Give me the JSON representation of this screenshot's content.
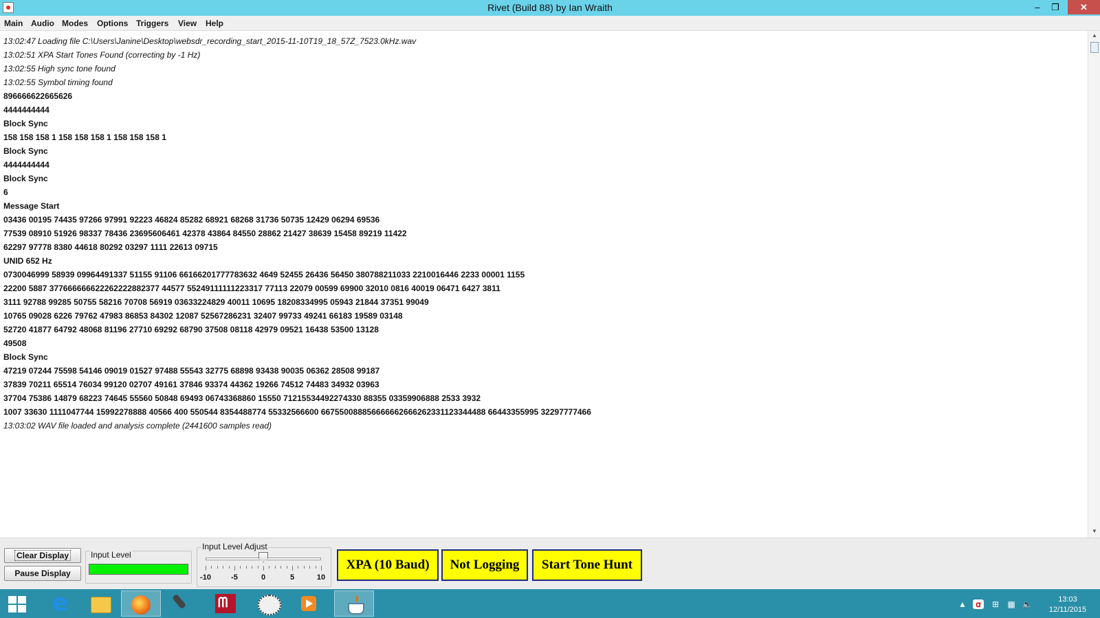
{
  "window": {
    "title": "Rivet (Build 88) by Ian Wraith",
    "minimize_glyph": "–",
    "maximize_glyph": "❐",
    "close_glyph": "✕"
  },
  "menu": [
    "Main",
    "Audio",
    "Modes",
    "Options",
    "Triggers",
    "View",
    "Help"
  ],
  "log": [
    {
      "text": "13:02:47 Loading file C:\\Users\\Janine\\Desktop\\websdr_recording_start_2015-11-10T19_18_57Z_7523.0kHz.wav",
      "style": "info"
    },
    {
      "text": "13:02:51 XPA Start Tones Found (correcting by -1 Hz)",
      "style": "info"
    },
    {
      "text": "13:02:55 High sync tone found",
      "style": "info"
    },
    {
      "text": "13:02:55 Symbol timing found",
      "style": "info"
    },
    {
      "text": "896666622665626",
      "style": "bold"
    },
    {
      "text": "4444444444",
      "style": "bold"
    },
    {
      "text": "Block Sync",
      "style": "bold"
    },
    {
      "text": "158 158 158 1 158 158 158 1 158 158 158 1",
      "style": "bold"
    },
    {
      "text": "Block Sync",
      "style": "bold"
    },
    {
      "text": "4444444444",
      "style": "bold"
    },
    {
      "text": "Block Sync",
      "style": "bold"
    },
    {
      "text": "6",
      "style": "bold"
    },
    {
      "text": "Message Start",
      "style": "bold"
    },
    {
      "text": "03436 00195 74435 97266 97991 92223 46824 85282 68921 68268 31736 50735 12429 06294 69536",
      "style": "bold"
    },
    {
      "text": "77539 08910 51926 98337 78436 23695606461 42378 43864 84550 28862 21427 38639 15458 89219 11422",
      "style": "bold"
    },
    {
      "text": "62297 97778 8380 44618 80292 03297 1111 22613 09715",
      "style": "bold"
    },
    {
      "text": "UNID 652 Hz",
      "style": "bold"
    },
    {
      "text": "0730046999 58939 09964491337 51155 91106 66166201777783632 4649 52455 26436 56450 380788211033 2210016446 2233 00001 1155",
      "style": "bold"
    },
    {
      "text": "22200 5887 377666666622262222882377 44577 55249111111223317 77113 22079 00599 69900 32010 0816 40019 06471 6427 3811",
      "style": "bold"
    },
    {
      "text": "3111 92788 99285 50755 58216 70708 56919 03633224829 40011 10695 18208334995 05943 21844 37351 99049",
      "style": "bold"
    },
    {
      "text": "10765 09028 6226 79762 47983 86853 84302 12087 52567286231 32407 99733 49241 66183 19589 03148",
      "style": "bold"
    },
    {
      "text": "52720 41877 64792 48068 81196 27710 69292 68790 37508 08118 42979 09521 16438 53500 13128",
      "style": "bold"
    },
    {
      "text": "49508",
      "style": "bold"
    },
    {
      "text": "Block Sync",
      "style": "bold"
    },
    {
      "text": "47219 07244 75598 54146 09019 01527 97488 55543 32775 68898 93438 90035 06362 28508 99187",
      "style": "bold"
    },
    {
      "text": "37839 70211 65514 76034 99120 02707 49161 37846 93374 44362 19266 74512 74483 34932 03963",
      "style": "bold"
    },
    {
      "text": "37704 75386 14879 68223 74645 55560 50848 69493 06743368860 15550 71215534492274330 88355 03359906888 2533 3932",
      "style": "bold"
    },
    {
      "text": "1007 33630 1111047744 15992278888 40566 400 550544 8354488774 55332566600 66755008885666666266626233112334448​8 66443355995 32297777466",
      "style": "bold"
    },
    {
      "text": "13:03:02 WAV file loaded and analysis complete (2441600 samples read)",
      "style": "info"
    }
  ],
  "scrollbar": {
    "up_glyph": "▲",
    "down_glyph": "▼"
  },
  "controls": {
    "clear_display": "Clear Display",
    "pause_display": "Pause Display",
    "input_level_label": "Input Level",
    "input_level_fraction": 1.0,
    "input_adjust_label": "Input Level Adjust",
    "slider": {
      "min": -10,
      "max": 10,
      "value": 0,
      "labels": [
        "-10",
        "-5",
        "0",
        "5",
        "10"
      ]
    },
    "mode_button": "XPA (10 Baud)",
    "logging_button": "Not Logging",
    "tone_hunt_button": "Start Tone Hunt",
    "accent_yellow": "#ffff00",
    "level_green": "#00f000"
  },
  "taskbar": {
    "apps": [
      "start-icon",
      "internet-explorer-icon",
      "file-explorer-icon",
      "firefox-icon",
      "microphone-icon",
      "mendeley-icon",
      "sheep-icon",
      "media-player-icon",
      "java-icon"
    ],
    "tray": {
      "up_glyph": "▲",
      "time": "13:03",
      "date": "12/11/2015"
    }
  }
}
